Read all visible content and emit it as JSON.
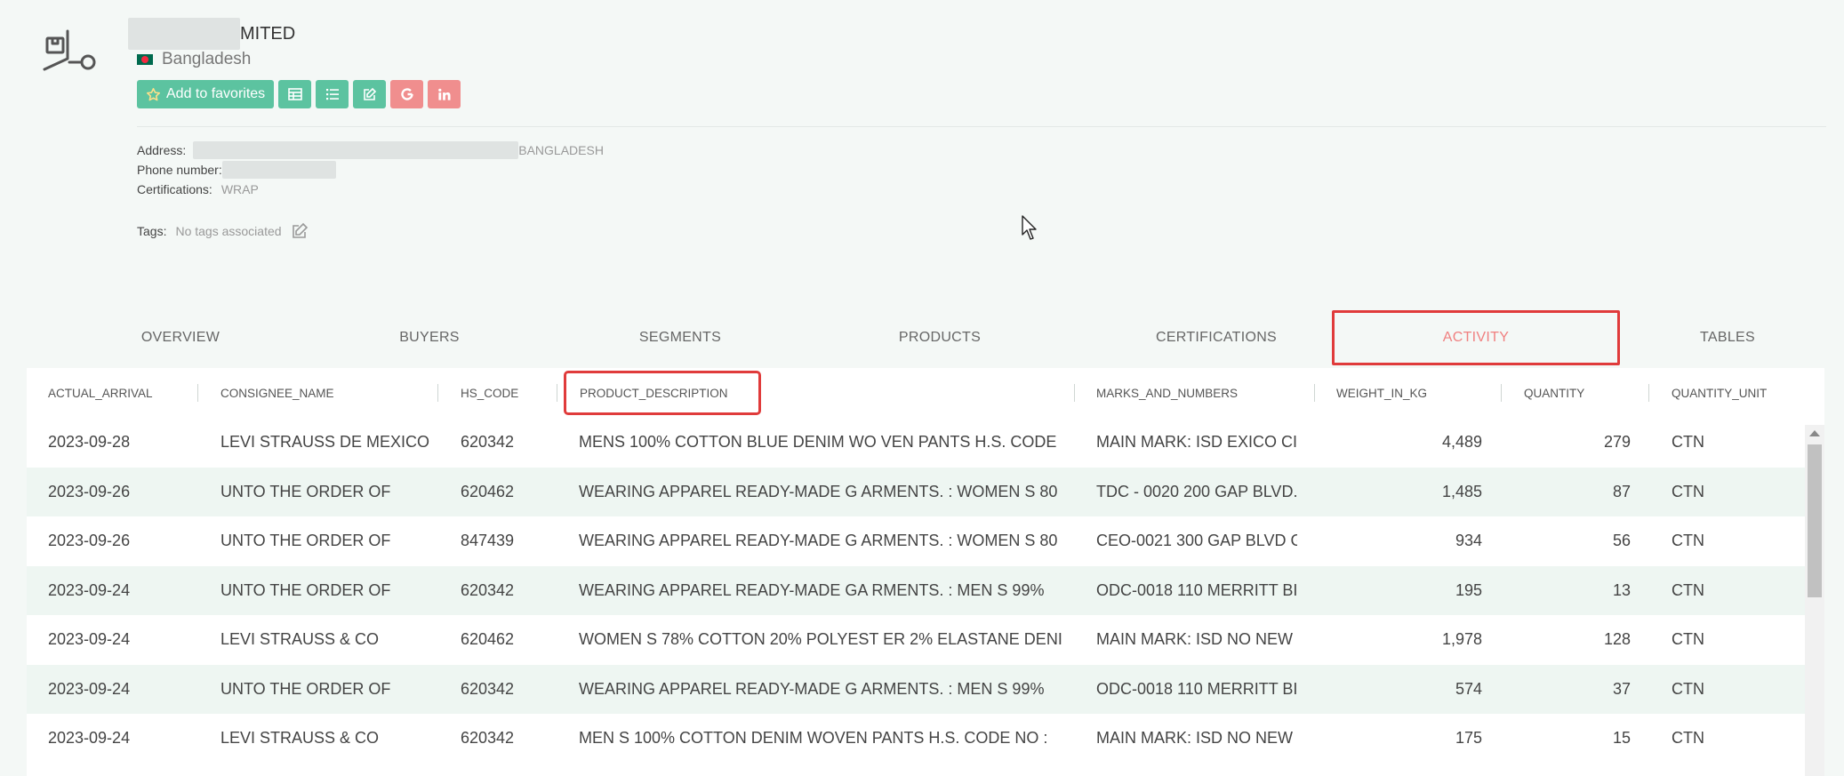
{
  "company": {
    "name_suffix": "MITED",
    "country": "Bangladesh"
  },
  "actions": {
    "favorites_label": "Add to favorites",
    "icons": [
      "table-icon",
      "list-icon",
      "edit-icon",
      "google-icon",
      "linkedin-icon"
    ]
  },
  "info": {
    "address_label": "Address:",
    "address_value": "BANGLADESH",
    "phone_label": "Phone number:",
    "cert_label": "Certifications:",
    "cert_value": "WRAP",
    "tags_label": "Tags:",
    "tags_value": "No tags associated"
  },
  "tabs": [
    {
      "label": "OVERVIEW"
    },
    {
      "label": "BUYERS"
    },
    {
      "label": "SEGMENTS"
    },
    {
      "label": "PRODUCTS"
    },
    {
      "label": "CERTIFICATIONS"
    },
    {
      "label": "ACTIVITY",
      "active": true
    },
    {
      "label": "TABLES"
    }
  ],
  "columns": [
    "ACTUAL_ARRIVAL",
    "CONSIGNEE_NAME",
    "HS_CODE",
    "PRODUCT_DESCRIPTION",
    "MARKS_AND_NUMBERS",
    "WEIGHT_IN_KG",
    "QUANTITY",
    "QUANTITY_UNIT"
  ],
  "rows": [
    [
      "2023-09-28",
      "LEVI STRAUSS DE MEXICO",
      "620342",
      "MENS 100% COTTON BLUE DENIM WO VEN PANTS H.S. CODE",
      "MAIN MARK: ISD EXICO CI",
      "4,489",
      "279",
      "CTN"
    ],
    [
      "2023-09-26",
      "UNTO THE ORDER OF",
      "620462",
      "WEARING APPAREL READY-MADE G ARMENTS. : WOMEN S 80",
      "TDC - 0020 200 GAP BLVD.",
      "1,485",
      "87",
      "CTN"
    ],
    [
      "2023-09-26",
      "UNTO THE ORDER OF",
      "847439",
      "WEARING APPAREL READY-MADE G ARMENTS. : WOMEN S 80",
      "CEO-0021 300 GAP BLVD G",
      "934",
      "56",
      "CTN"
    ],
    [
      "2023-09-24",
      "UNTO THE ORDER OF",
      "620342",
      "WEARING APPAREL READY-MADE GA RMENTS. : MEN S 99%",
      "ODC-0018 110 MERRITT BI",
      "195",
      "13",
      "CTN"
    ],
    [
      "2023-09-24",
      "LEVI STRAUSS & CO",
      "620462",
      "WOMEN S 78% COTTON 20% POLYEST ER 2% ELASTANE DENI",
      "MAIN MARK: ISD NO NEW",
      "1,978",
      "128",
      "CTN"
    ],
    [
      "2023-09-24",
      "UNTO THE ORDER OF",
      "620342",
      "WEARING APPAREL READY-MADE G ARMENTS. : MEN S 99%",
      "ODC-0018 110 MERRITT BI",
      "574",
      "37",
      "CTN"
    ],
    [
      "2023-09-24",
      "LEVI STRAUSS & CO",
      "620342",
      "MEN S 100% COTTON DENIM WOVEN PANTS H.S. CODE NO :",
      "MAIN MARK: ISD NO NEW",
      "175",
      "15",
      "CTN"
    ]
  ]
}
